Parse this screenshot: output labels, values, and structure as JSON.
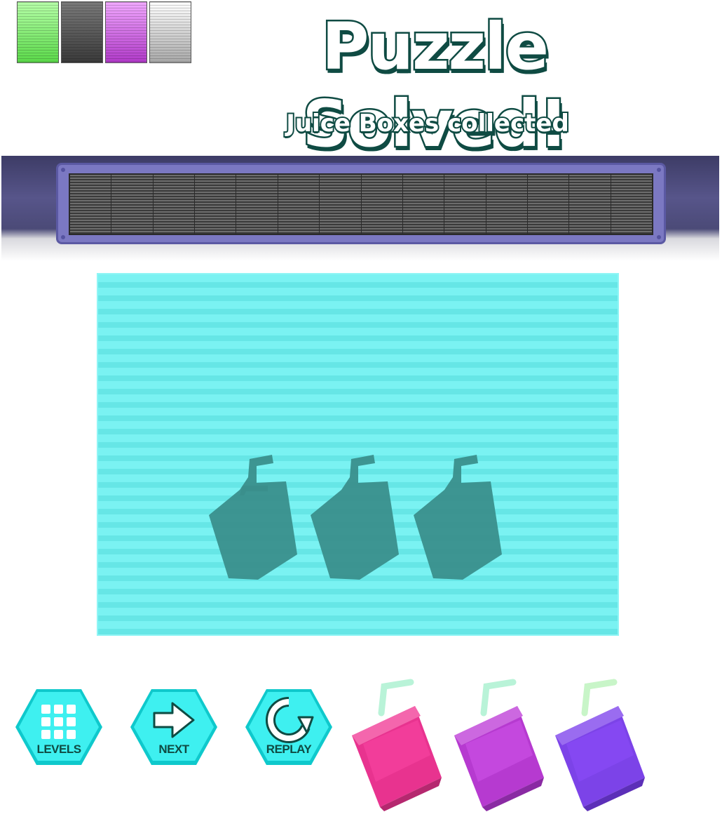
{
  "header": {
    "title": "Puzzle Solved!",
    "subtitle": "Juice Boxes collected"
  },
  "swatches": [
    "#5bd94a",
    "#3a3a3a",
    "#b13ac9",
    "#ffffff"
  ],
  "grill": {
    "cells": 14
  },
  "slots": {
    "count": 3,
    "color": "#3a8f8c"
  },
  "buttons": {
    "levels": "LEVELS",
    "next": "NEXT",
    "replay": "REPLAY"
  },
  "collected": [
    {
      "color": "#e8338f",
      "dark": "#b5286f"
    },
    {
      "color": "#b63ad0",
      "dark": "#8a2aa3"
    },
    {
      "color": "#7c43e8",
      "dark": "#5c2fb8"
    }
  ],
  "colors": {
    "accent": "#1fd8da",
    "title_outline": "#0f4b43",
    "screen": "#7af2f2"
  }
}
